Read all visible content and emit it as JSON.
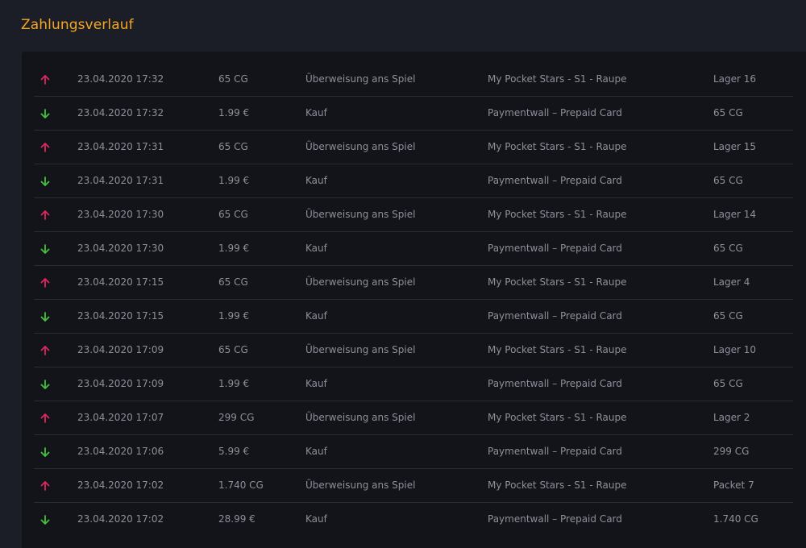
{
  "header": {
    "title": "Zahlungsverlauf"
  },
  "colors": {
    "accent": "#f5a623",
    "out": "#e0245e",
    "in": "#43c23a"
  },
  "transactions": [
    {
      "direction": "out",
      "icon": "arrow-up-icon",
      "date": "23.04.2020 17:32",
      "amount": "65 CG",
      "type": "Überweisung ans Spiel",
      "target": "My Pocket Stars - S1 - Raupe",
      "extra": "Lager 16"
    },
    {
      "direction": "in",
      "icon": "arrow-down-icon",
      "date": "23.04.2020 17:32",
      "amount": "1.99 €",
      "type": "Kauf",
      "target": "Paymentwall – Prepaid Card",
      "extra": "65 CG"
    },
    {
      "direction": "out",
      "icon": "arrow-up-icon",
      "date": "23.04.2020 17:31",
      "amount": "65 CG",
      "type": "Überweisung ans Spiel",
      "target": "My Pocket Stars - S1 - Raupe",
      "extra": "Lager 15"
    },
    {
      "direction": "in",
      "icon": "arrow-down-icon",
      "date": "23.04.2020 17:31",
      "amount": "1.99 €",
      "type": "Kauf",
      "target": "Paymentwall – Prepaid Card",
      "extra": "65 CG"
    },
    {
      "direction": "out",
      "icon": "arrow-up-icon",
      "date": "23.04.2020 17:30",
      "amount": "65 CG",
      "type": "Überweisung ans Spiel",
      "target": "My Pocket Stars - S1 - Raupe",
      "extra": "Lager 14"
    },
    {
      "direction": "in",
      "icon": "arrow-down-icon",
      "date": "23.04.2020 17:30",
      "amount": "1.99 €",
      "type": "Kauf",
      "target": "Paymentwall – Prepaid Card",
      "extra": "65 CG"
    },
    {
      "direction": "out",
      "icon": "arrow-up-icon",
      "date": "23.04.2020 17:15",
      "amount": "65 CG",
      "type": "Überweisung ans Spiel",
      "target": "My Pocket Stars - S1 - Raupe",
      "extra": "Lager 4"
    },
    {
      "direction": "in",
      "icon": "arrow-down-icon",
      "date": "23.04.2020 17:15",
      "amount": "1.99 €",
      "type": "Kauf",
      "target": "Paymentwall – Prepaid Card",
      "extra": "65 CG"
    },
    {
      "direction": "out",
      "icon": "arrow-up-icon",
      "date": "23.04.2020 17:09",
      "amount": "65 CG",
      "type": "Überweisung ans Spiel",
      "target": "My Pocket Stars - S1 - Raupe",
      "extra": "Lager 10"
    },
    {
      "direction": "in",
      "icon": "arrow-down-icon",
      "date": "23.04.2020 17:09",
      "amount": "1.99 €",
      "type": "Kauf",
      "target": "Paymentwall – Prepaid Card",
      "extra": "65 CG"
    },
    {
      "direction": "out",
      "icon": "arrow-up-icon",
      "date": "23.04.2020 17:07",
      "amount": "299 CG",
      "type": "Überweisung ans Spiel",
      "target": "My Pocket Stars - S1 - Raupe",
      "extra": "Lager 2"
    },
    {
      "direction": "in",
      "icon": "arrow-down-icon",
      "date": "23.04.2020 17:06",
      "amount": "5.99 €",
      "type": "Kauf",
      "target": "Paymentwall – Prepaid Card",
      "extra": "299 CG"
    },
    {
      "direction": "out",
      "icon": "arrow-up-icon",
      "date": "23.04.2020 17:02",
      "amount": "1.740 CG",
      "type": "Überweisung ans Spiel",
      "target": "My Pocket Stars - S1 - Raupe",
      "extra": "Packet 7"
    },
    {
      "direction": "in",
      "icon": "arrow-down-icon",
      "date": "23.04.2020 17:02",
      "amount": "28.99 €",
      "type": "Kauf",
      "target": "Paymentwall – Prepaid Card",
      "extra": "1.740 CG"
    }
  ]
}
